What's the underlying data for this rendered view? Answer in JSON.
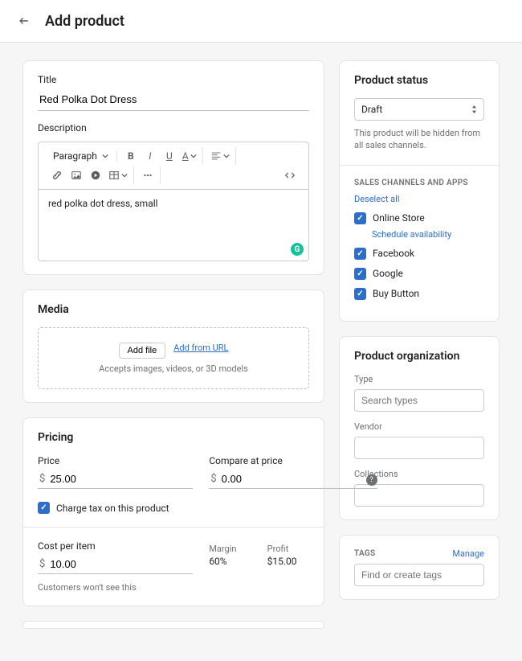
{
  "header": {
    "title": "Add product"
  },
  "product": {
    "title_label": "Title",
    "title_value": "Red Polka Dot Dress",
    "desc_label": "Description",
    "desc_value": "red polka dot dress, small",
    "rte_format": "Paragraph"
  },
  "media": {
    "heading": "Media",
    "add_file": "Add file",
    "add_url": "Add from URL",
    "hint": "Accepts images, videos, or 3D models"
  },
  "pricing": {
    "heading": "Pricing",
    "price_label": "Price",
    "price_value": "25.00",
    "compare_label": "Compare at price",
    "compare_value": "0.00",
    "currency": "$",
    "tax_label": "Charge tax on this product",
    "cost_label": "Cost per item",
    "cost_value": "10.00",
    "cost_note": "Customers won't see this",
    "margin_label": "Margin",
    "margin_value": "60%",
    "profit_label": "Profit",
    "profit_value": "$15.00"
  },
  "status": {
    "heading": "Product status",
    "value": "Draft",
    "note": "This product will be hidden from all sales channels.",
    "channels_heading": "SALES CHANNELS AND APPS",
    "deselect": "Deselect all",
    "schedule": "Schedule availability",
    "channels": [
      "Online Store",
      "Facebook",
      "Google",
      "Buy Button"
    ]
  },
  "org": {
    "heading": "Product organization",
    "type_label": "Type",
    "type_placeholder": "Search types",
    "vendor_label": "Vendor",
    "collections_label": "Collections"
  },
  "tags": {
    "heading": "TAGS",
    "manage": "Manage",
    "placeholder": "Find or create tags"
  }
}
